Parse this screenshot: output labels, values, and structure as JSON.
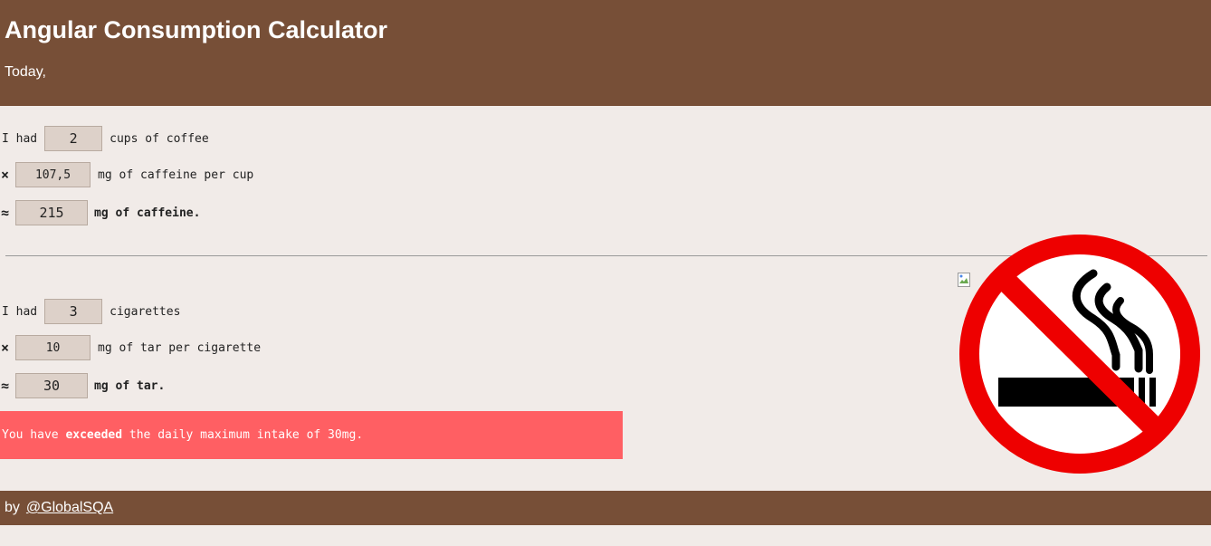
{
  "header": {
    "title": "Angular Consumption Calculator",
    "subtitle": "Today,"
  },
  "coffee": {
    "prefix": "I had",
    "cups": "2",
    "cups_label": "cups of coffee",
    "times": "×",
    "per_cup": "107,5",
    "per_cup_label": "mg of caffeine per cup",
    "approx": "≈",
    "total": "215",
    "total_label": "mg of caffeine."
  },
  "cigarettes": {
    "prefix": "I had",
    "count": "3",
    "count_label": "cigarettes",
    "times": "×",
    "tar_per": "10",
    "tar_per_label": "mg of tar per cigarette",
    "approx": "≈",
    "total": "30",
    "total_label": "mg of tar."
  },
  "alert": {
    "pre": "You have ",
    "emph": "exceeded",
    "post": " the daily maximum intake of 30mg."
  },
  "footer": {
    "by": "by",
    "link": "@GlobalSQA"
  },
  "colors": {
    "brand": "#774f37",
    "background": "#f1ebe8",
    "alert": "#ff5f63",
    "input": "#ddd1c9"
  },
  "icons": {
    "no_smoking": "no-smoking-icon",
    "broken_image": "broken-image-icon"
  }
}
